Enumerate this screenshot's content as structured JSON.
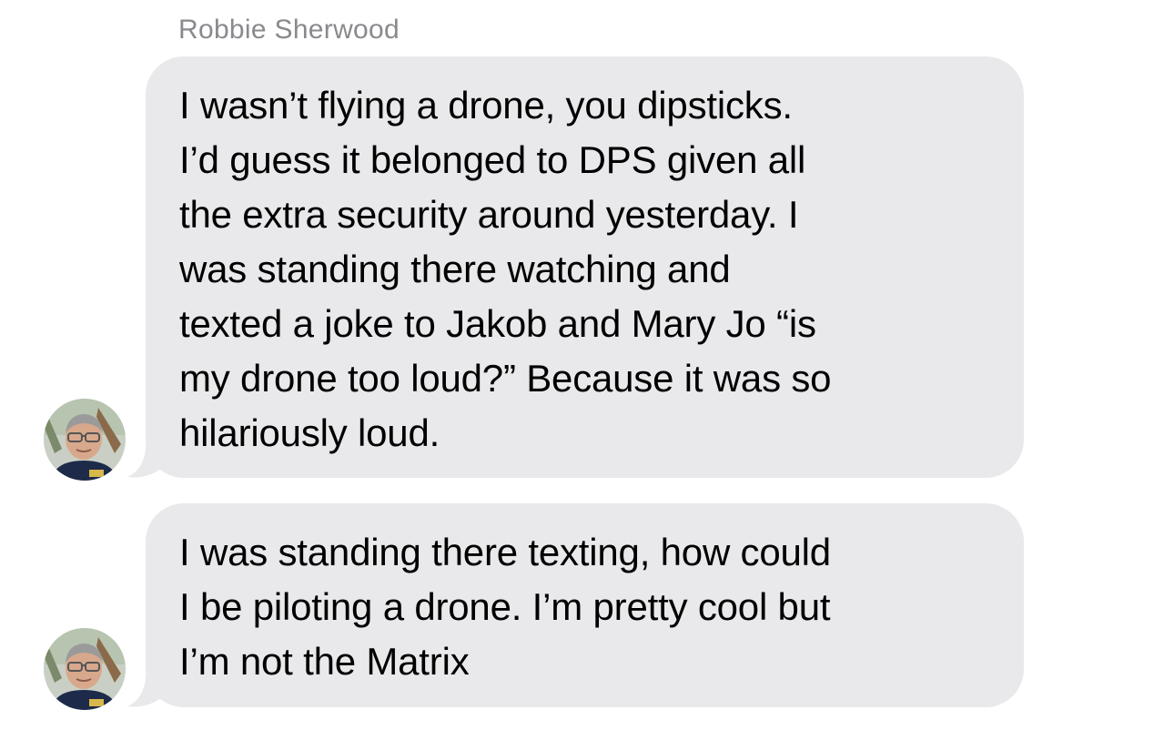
{
  "conversation": {
    "sender_name": "Robbie Sherwood",
    "messages": [
      {
        "lines": [
          "I wasn’t flying a drone, you dipsticks.",
          "I’d guess it belonged to DPS given all",
          "the extra security around yesterday. I",
          "was standing there watching and",
          "texted a joke to Jakob and Mary Jo “is",
          "my drone too loud?” Because it was so",
          "hilariously loud."
        ]
      },
      {
        "lines": [
          "I was standing there texting, how could",
          "I be piloting a drone. I’m pretty cool but",
          "I’m not the Matrix"
        ]
      }
    ]
  },
  "colors": {
    "bubble_bg": "#e9e9eb",
    "sender_name": "#8a8a8e",
    "message_text": "#000000"
  },
  "icons": {
    "avatar": "person-photo-avatar"
  }
}
